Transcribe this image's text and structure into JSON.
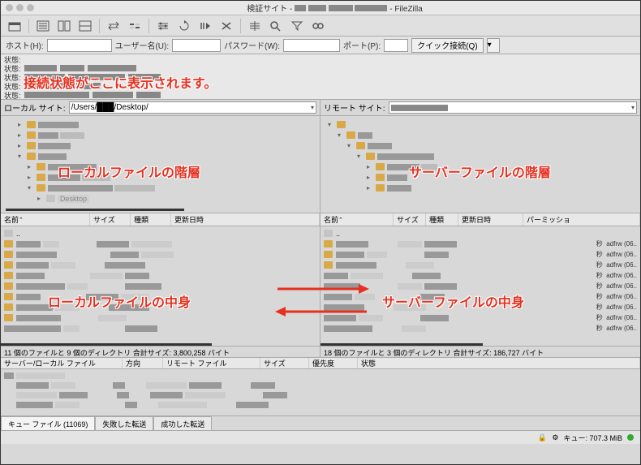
{
  "title_suffix": " - FileZilla",
  "title_prefix": "検証サイト - ",
  "quickconnect": {
    "host_label": "ホスト(H):",
    "user_label": "ユーザー名(U):",
    "pass_label": "パスワード(W):",
    "port_label": "ポート(P):",
    "button": "クイック接続(Q)"
  },
  "log": {
    "status_label": "状態:"
  },
  "sites": {
    "local_label": "ローカル サイト:",
    "local_path": "/Users/███/Desktop/",
    "remote_label": "リモート サイト:"
  },
  "tree": {
    "desktop_label": "Desktop"
  },
  "columns": {
    "name": "名前",
    "size": "サイズ",
    "type": "種類",
    "modified": "更新日時",
    "permissions": "パーミッショ"
  },
  "list": {
    "parent": "..",
    "perm_sample": "adfrw (06..",
    "sec": "秒"
  },
  "status": {
    "local": "11 個のファイルと 9 個のディレクトリ 合計サイズ: 3,800,258 バイト",
    "remote": "18 個のファイルと 3 個のディレクトリ 合計サイズ: 186,727 バイト"
  },
  "queue": {
    "server_file": "サーバー/ローカル ファイル",
    "direction": "方向",
    "remote_file": "リモート ファイル",
    "size": "サイズ",
    "priority": "優先度",
    "status_col": "状態"
  },
  "tabs": {
    "queue": "キュー ファイル (11069)",
    "failed": "失敗した転送",
    "success": "成功した転送"
  },
  "statusbar": {
    "queue_size": "キュー: 707.3 MiB"
  },
  "annotations": {
    "connection": "接続状態がここに表示されます。",
    "local_tree": "ローカルファイルの階層",
    "remote_tree": "サーバーファイルの階層",
    "local_list": "ローカルファイルの中身",
    "remote_list": "サーバーファイルの中身"
  }
}
